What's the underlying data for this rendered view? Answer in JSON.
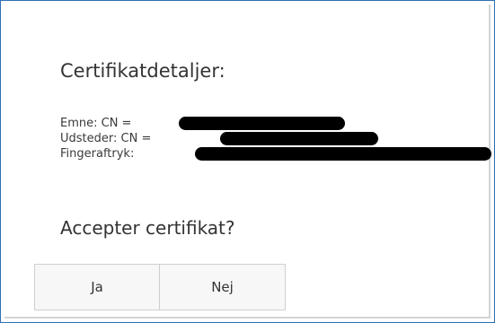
{
  "dialog": {
    "title": "Certifikatdetaljer:",
    "details": {
      "subject_label": "Emne: CN =",
      "issuer_label": "Udsteder: CN =",
      "fingerprint_label": "Fingeraftryk:"
    },
    "question": "Accepter certifikat?",
    "buttons": {
      "yes_label": "Ja",
      "no_label": "Nej"
    }
  }
}
